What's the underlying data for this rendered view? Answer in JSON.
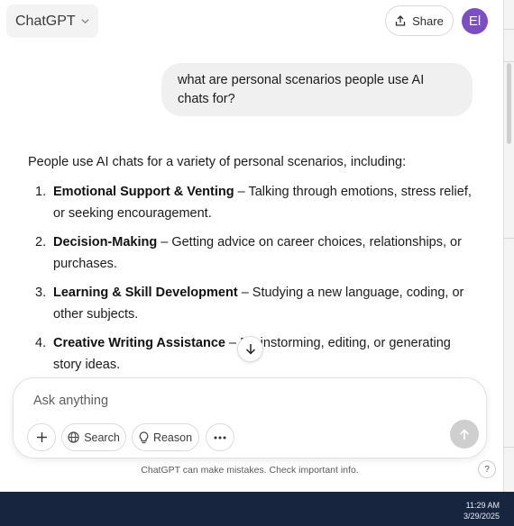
{
  "header": {
    "model_name": "ChatGPT",
    "share_label": "Share",
    "avatar_initials": "El"
  },
  "conversation": {
    "user_message": "what are personal scenarios people use AI chats for?",
    "assistant": {
      "intro": "People use AI chats for a variety of personal scenarios, including:",
      "items": [
        {
          "number": "1.",
          "title": "Emotional Support & Venting",
          "text": " – Talking through emotions, stress relief, or seeking encouragement."
        },
        {
          "number": "2.",
          "title": "Decision-Making",
          "text": " – Getting advice on career choices, relationships, or purchases."
        },
        {
          "number": "3.",
          "title": "Learning & Skill Development",
          "text": " – Studying a new language, coding, or other subjects."
        },
        {
          "number": "4.",
          "title": "Creative Writing Assistance",
          "text": " – Brainstorming, editing, or generating story ideas."
        }
      ]
    }
  },
  "composer": {
    "placeholder": "Ask anything",
    "search_label": "Search",
    "reason_label": "Reason"
  },
  "footer": {
    "disclaimer": "ChatGPT can make mistakes. Check important info.",
    "help_label": "?"
  },
  "taskbar": {
    "time": "11:29 AM",
    "date": "3/29/2025"
  },
  "colors": {
    "avatar": "#7b4fc4",
    "taskbar": "#17253f",
    "user_bubble": "#f0f0f0",
    "send_disabled": "#cfcfcf"
  },
  "icons": [
    "chevron-down-icon",
    "share-icon",
    "arrow-down-icon",
    "plus-icon",
    "globe-icon",
    "lightbulb-icon",
    "ellipsis-icon",
    "arrow-up-icon"
  ]
}
